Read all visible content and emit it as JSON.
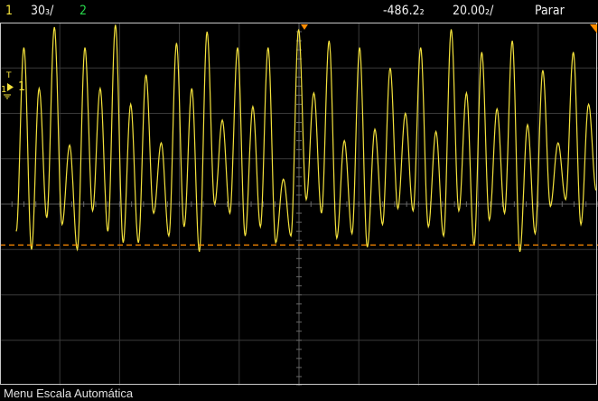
{
  "header": {
    "channel1_number": "1",
    "channel1_scale": "30₃/",
    "channel2_number": "2",
    "time_offset": "-486.2₂",
    "time_scale": "20.00₂/",
    "run_state": "Parar"
  },
  "screen": {
    "channel1_marker_label": "1",
    "trigger_marker_label": "T",
    "colors": {
      "channel1": "#f4e23c",
      "channel2": "#27d64a",
      "grid": "#3a3a3a",
      "cursor": "#ff8c00",
      "background": "#000000",
      "frame": "#c8c8c8"
    },
    "grid": {
      "horizontal_divisions": 10,
      "vertical_divisions": 8
    }
  },
  "footer": {
    "menu_label": "Menu Escala Automática"
  },
  "waveform": {
    "cursor_levels_div": [
      4.0,
      -0.9
    ],
    "peaks_div": [
      3.45,
      2.55,
      3.9,
      1.3,
      3.45,
      2.55,
      3.95,
      2.2,
      2.85,
      1.35,
      3.55,
      2.55,
      3.8,
      1.85,
      3.45,
      2.15,
      3.45,
      0.55,
      3.85,
      2.45,
      3.6,
      1.4,
      3.45,
      1.65,
      3.0,
      2.0,
      3.45,
      1.6,
      3.85,
      2.45,
      3.35,
      2.1,
      3.6,
      1.75,
      2.95,
      1.35,
      3.35,
      2.2
    ],
    "troughs_div": [
      -0.6,
      -1.0,
      -0.3,
      -0.45,
      -1.0,
      -0.15,
      -0.6,
      -0.85,
      -0.85,
      -0.2,
      -0.7,
      -0.5,
      -1.05,
      0.0,
      -0.2,
      -0.7,
      -0.5,
      -0.85,
      -0.7,
      0.1,
      -0.2,
      -0.75,
      -0.65,
      -0.95,
      -0.45,
      -0.1,
      -0.15,
      -0.5,
      -0.7,
      -0.15,
      -0.9,
      -0.35,
      -0.2,
      -1.05,
      -0.65,
      -0.05,
      0.1,
      -0.45,
      0.3
    ]
  }
}
